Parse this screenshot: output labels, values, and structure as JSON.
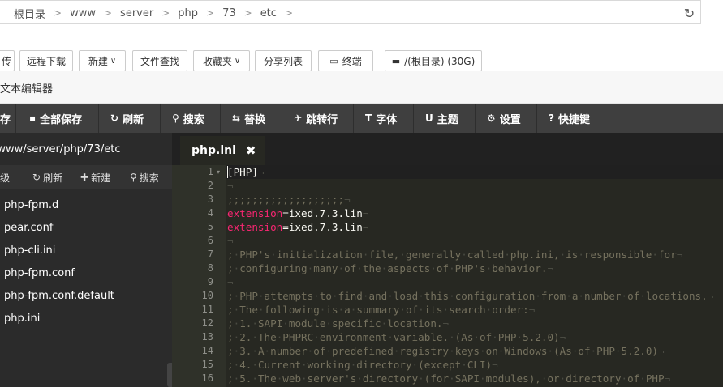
{
  "breadcrumb": [
    "根目录",
    "www",
    "server",
    "php",
    "73",
    "etc"
  ],
  "toolbar": {
    "buttons": [
      {
        "label": "传",
        "name": "upload-button"
      },
      {
        "label": "远程下载",
        "name": "remote-download-button"
      },
      {
        "label": "新建",
        "name": "new-button",
        "chevron": "∨"
      },
      {
        "label": "文件查找",
        "name": "file-search-button"
      },
      {
        "label": "收藏夹",
        "name": "favorites-button",
        "chevron": "∨"
      },
      {
        "label": "分享列表",
        "name": "share-list-button"
      },
      {
        "label": "终端",
        "name": "terminal-button",
        "icon": "terminal-icon"
      },
      {
        "label": "/(根目录) (30G)",
        "name": "disk-button",
        "icon": "disk-icon"
      }
    ]
  },
  "editor": {
    "title": "文本编辑器",
    "menu": [
      "存",
      "全部保存",
      "刷新",
      "搜索",
      "替换",
      "跳转行",
      "字体",
      "主题",
      "设置",
      "快捷键"
    ],
    "path": "/www/server/php/73/etc",
    "actions": [
      "级",
      "刷新",
      "新建",
      "搜索"
    ],
    "files": [
      "php-fpm.d",
      "pear.conf",
      "php-cli.ini",
      "php-fpm.conf",
      "php-fpm.conf.default",
      "php.ini"
    ],
    "tab": {
      "label": "php.ini",
      "close": "✖"
    },
    "line_numbers": [
      "1",
      "2",
      "3",
      "4",
      "5",
      "6",
      "7",
      "8",
      "9",
      "10",
      "11",
      "12",
      "13",
      "14",
      "15",
      "16"
    ],
    "lines": [
      "[PHP]",
      "",
      ";;;;;;;;;;;;;;;;;;;",
      "extension=ixed.7.3.lin",
      "extension=ixed.7.3.lin",
      "",
      "; PHP's initialization file, generally called php.ini, is responsible for",
      "; configuring many of the aspects of PHP's behavior.",
      "",
      "; PHP attempts to find and load this configuration from a number of locations.",
      "; The following is a summary of its search order:",
      "; 1. SAPI module specific location.",
      "; 2. The PHPRC environment variable. (As of PHP 5.2.0)",
      "; 3. A number of predefined registry keys on Windows (As of PHP 5.2.0)",
      "; 4. Current working directory (except CLI)",
      "; 5. The web server's directory (for SAPI modules), or directory of PHP"
    ]
  }
}
